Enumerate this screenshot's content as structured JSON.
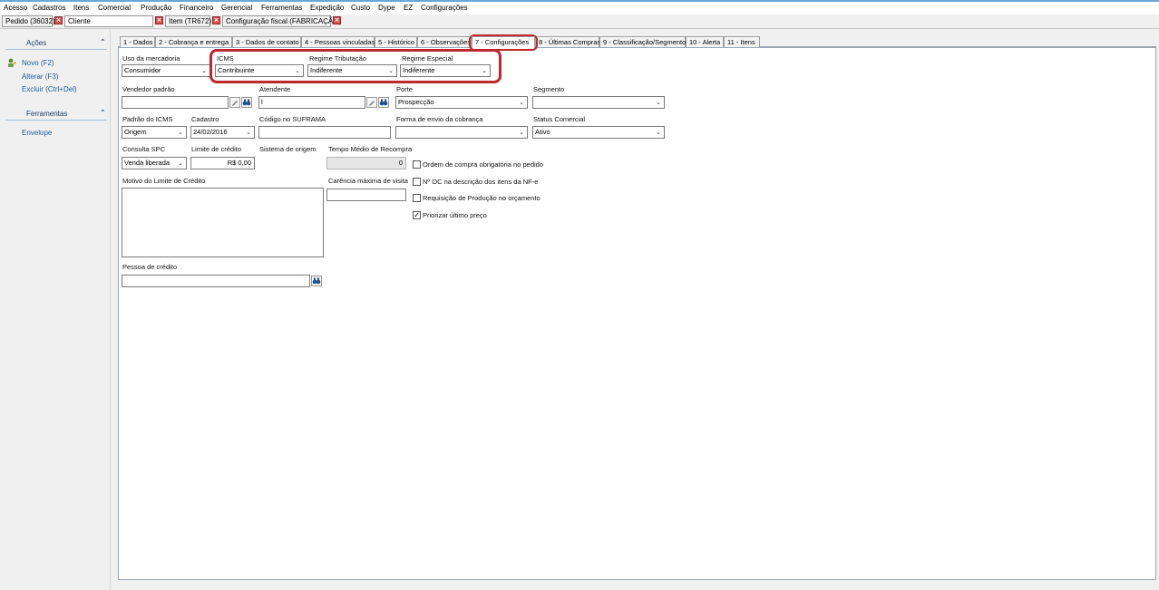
{
  "menu": [
    "Acesso",
    "Cadastros",
    "Itens",
    "Comercial",
    "Produção",
    "Financeiro",
    "Gerencial",
    "Ferramentas",
    "Expedição",
    "Custo",
    "Dype",
    "EZ",
    "Configurações"
  ],
  "doc_tabs": {
    "pedido": "Pedido (36032)",
    "cliente": "Cliente",
    "item": "Item (TR672)",
    "config_fiscal": "Configuração fiscal (FABRICAÇÃO)"
  },
  "sidebar": {
    "acoes_title": "Ações",
    "novo": "Novo (F2)",
    "alterar": "Alterar (F3)",
    "excluir": "Excluir (Ctrl+Del)",
    "ferramentas_title": "Ferramentas",
    "envelope": "Envelope"
  },
  "tabs": [
    "1 - Dados",
    "2 - Cobrança e entrega",
    "3 - Dados de contato",
    "4 - Pessoas vinculadas",
    "5 - Histórico",
    "6 - Observações",
    "7 - Configurações",
    "8 - Últimas Compras",
    "9 - Classificação/Segmento",
    "10 - Alerta",
    "11 - Itens"
  ],
  "form": {
    "uso_mercadoria": {
      "label": "Uso da mercadoria",
      "value": "Consumidor"
    },
    "icms": {
      "label": "ICMS",
      "value": "Contribuinte"
    },
    "regime_tributacao": {
      "label": "Regime Tributação",
      "value": "Indiferente"
    },
    "regime_especial": {
      "label": "Regime Especial",
      "value": "Indiferente"
    },
    "vendedor_padrao": {
      "label": "Vendedor padrão",
      "value": ""
    },
    "atendente": {
      "label": "Atendente",
      "value": "l"
    },
    "porte": {
      "label": "Porte",
      "value": "Prospecção"
    },
    "segmento": {
      "label": "Segmento",
      "value": ""
    },
    "padrao_icms": {
      "label": "Padrão do ICMS",
      "value": "Origem"
    },
    "cadastro": {
      "label": "Cadastro",
      "value": "24/02/2016"
    },
    "codigo_suframa": {
      "label": "Código no SUFRAMA",
      "value": ""
    },
    "forma_envio_cobranca": {
      "label": "Forma de envio da cobrança",
      "value": ""
    },
    "status_comercial": {
      "label": "Status Comercial",
      "value": "Ativo"
    },
    "consulta_spc": {
      "label": "Consulta SPC",
      "value": "Venda liberada"
    },
    "limite_credito": {
      "label": "Limite de crédito",
      "value": "R$ 0,00"
    },
    "sistema_origem": {
      "label": "Sistema de origem"
    },
    "tempo_medio_recompra": {
      "label": "Tempo Médio de Recompra",
      "value": "0"
    },
    "motivo_limite": {
      "label": "Motivo do Limite de Crédito"
    },
    "carencia_maxima": {
      "label": "Carência máxima de visita",
      "value": ""
    },
    "pessoa_credito": {
      "label": "Pessoa de crédito",
      "value": ""
    }
  },
  "checkboxes": [
    {
      "label": "Ordem de compra obrigatória no pedido",
      "checked": false
    },
    {
      "label": "Nº OC na descrição dos itens da NF-e",
      "checked": false
    },
    {
      "label": "Requisição de Produção no orçamento",
      "checked": false
    },
    {
      "label": "Priorizar último preço",
      "checked": true
    }
  ],
  "colors": {
    "highlight": "#c0262e",
    "link": "#1c5c9c",
    "close": "#d9534f"
  },
  "icons": {
    "close": "close-icon",
    "binoculars": "binoculars-icon",
    "edit": "edit-icon",
    "new": "new-icon",
    "chevron": "chevron-up-icon",
    "dropdown": "dropdown-arrow-icon"
  }
}
